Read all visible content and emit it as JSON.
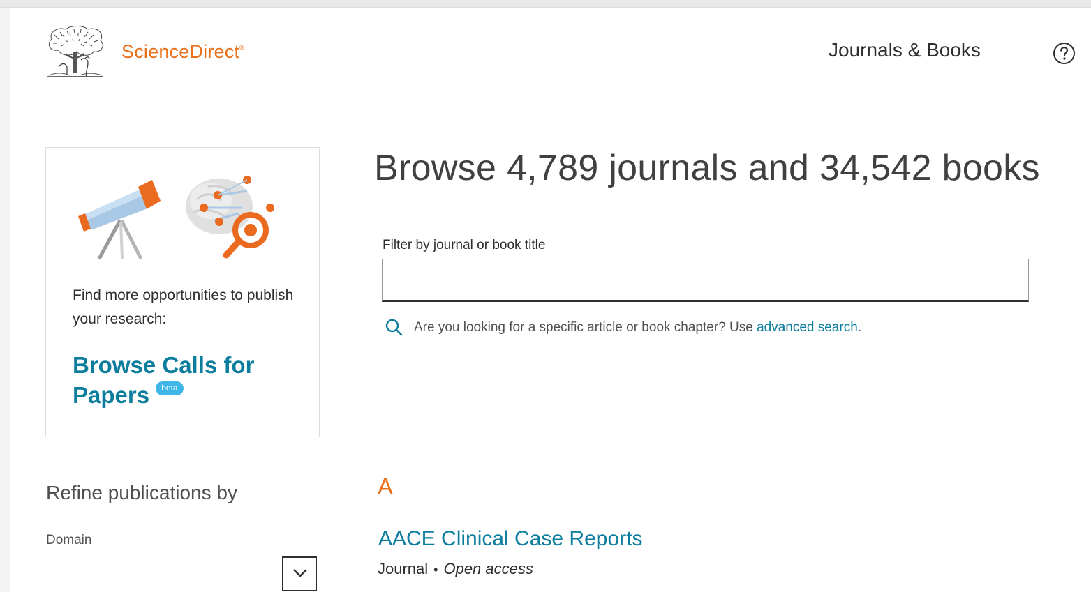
{
  "header": {
    "brand_name": "ScienceDirect",
    "brand_mark": "®",
    "nav_journals_books": "Journals & Books",
    "help_icon": "question-circle-icon"
  },
  "promo": {
    "text": "Find more opportunities to publish your research:",
    "link_label": "Browse Calls for Papers",
    "badge": "beta"
  },
  "main": {
    "title": "Browse 4,789 journals and 34,542 books",
    "filter": {
      "label": "Filter by journal or book title",
      "value": "",
      "placeholder": ""
    },
    "hint": {
      "text": "Are you looking for a specific article or book chapter? Use",
      "link": "advanced search",
      "suffix": "."
    }
  },
  "refine": {
    "title": "Refine publications by",
    "domain_label": "Domain"
  },
  "results": {
    "letter": "A",
    "items": [
      {
        "title": "AACE Clinical Case Reports",
        "type": "Journal",
        "access": "Open access"
      }
    ]
  },
  "colors": {
    "brand_orange": "#e9711c",
    "link_blue": "#0c7d9d",
    "beta_blue": "#3fb6e8"
  }
}
